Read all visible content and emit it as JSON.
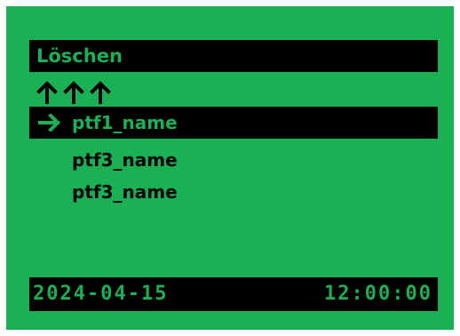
{
  "colors": {
    "screen_background": "#1ab154",
    "bar_background": "#000000",
    "bar_text": "#1ab154",
    "row_text": "#000000"
  },
  "header": {
    "title": "Löschen"
  },
  "navigation": {
    "up_icon": "up-arrow-icon",
    "up_arrow_count": 3
  },
  "list": {
    "pointer_icon": "right-arrow-icon",
    "items": [
      {
        "label": "ptf1_name",
        "selected": true
      },
      {
        "label": "ptf3_name",
        "selected": false
      },
      {
        "label": "ptf3_name",
        "selected": false
      }
    ]
  },
  "status": {
    "date": "2024-04-15",
    "time": "12:00:00"
  }
}
